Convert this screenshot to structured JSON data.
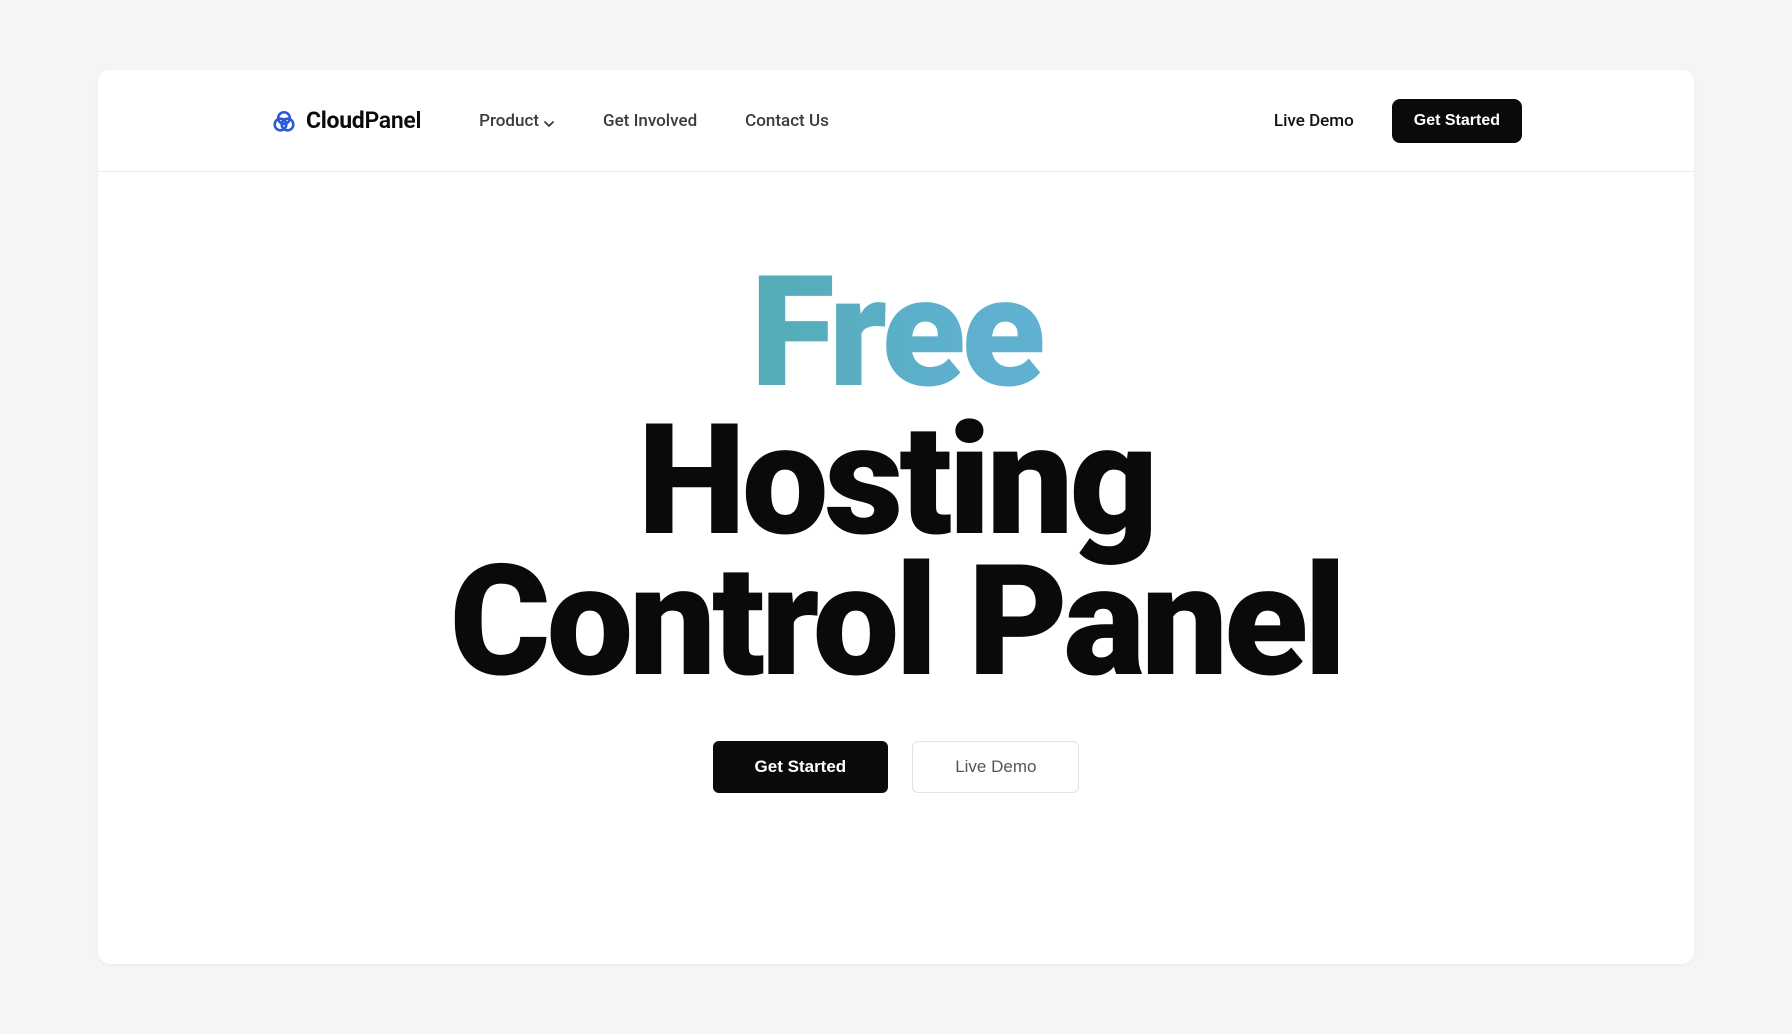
{
  "brand": {
    "name_part1": "Cloud",
    "name_part2": "Panel"
  },
  "nav": {
    "items": [
      {
        "label": "Product",
        "has_dropdown": true
      },
      {
        "label": "Get Involved",
        "has_dropdown": false
      },
      {
        "label": "Contact Us",
        "has_dropdown": false
      }
    ],
    "live_demo": "Live Demo",
    "get_started": "Get Started"
  },
  "hero": {
    "word_free": "Free",
    "line_hosting": "Hosting",
    "line_control_panel": "Control Panel",
    "cta_primary": "Get Started",
    "cta_secondary": "Live Demo"
  }
}
